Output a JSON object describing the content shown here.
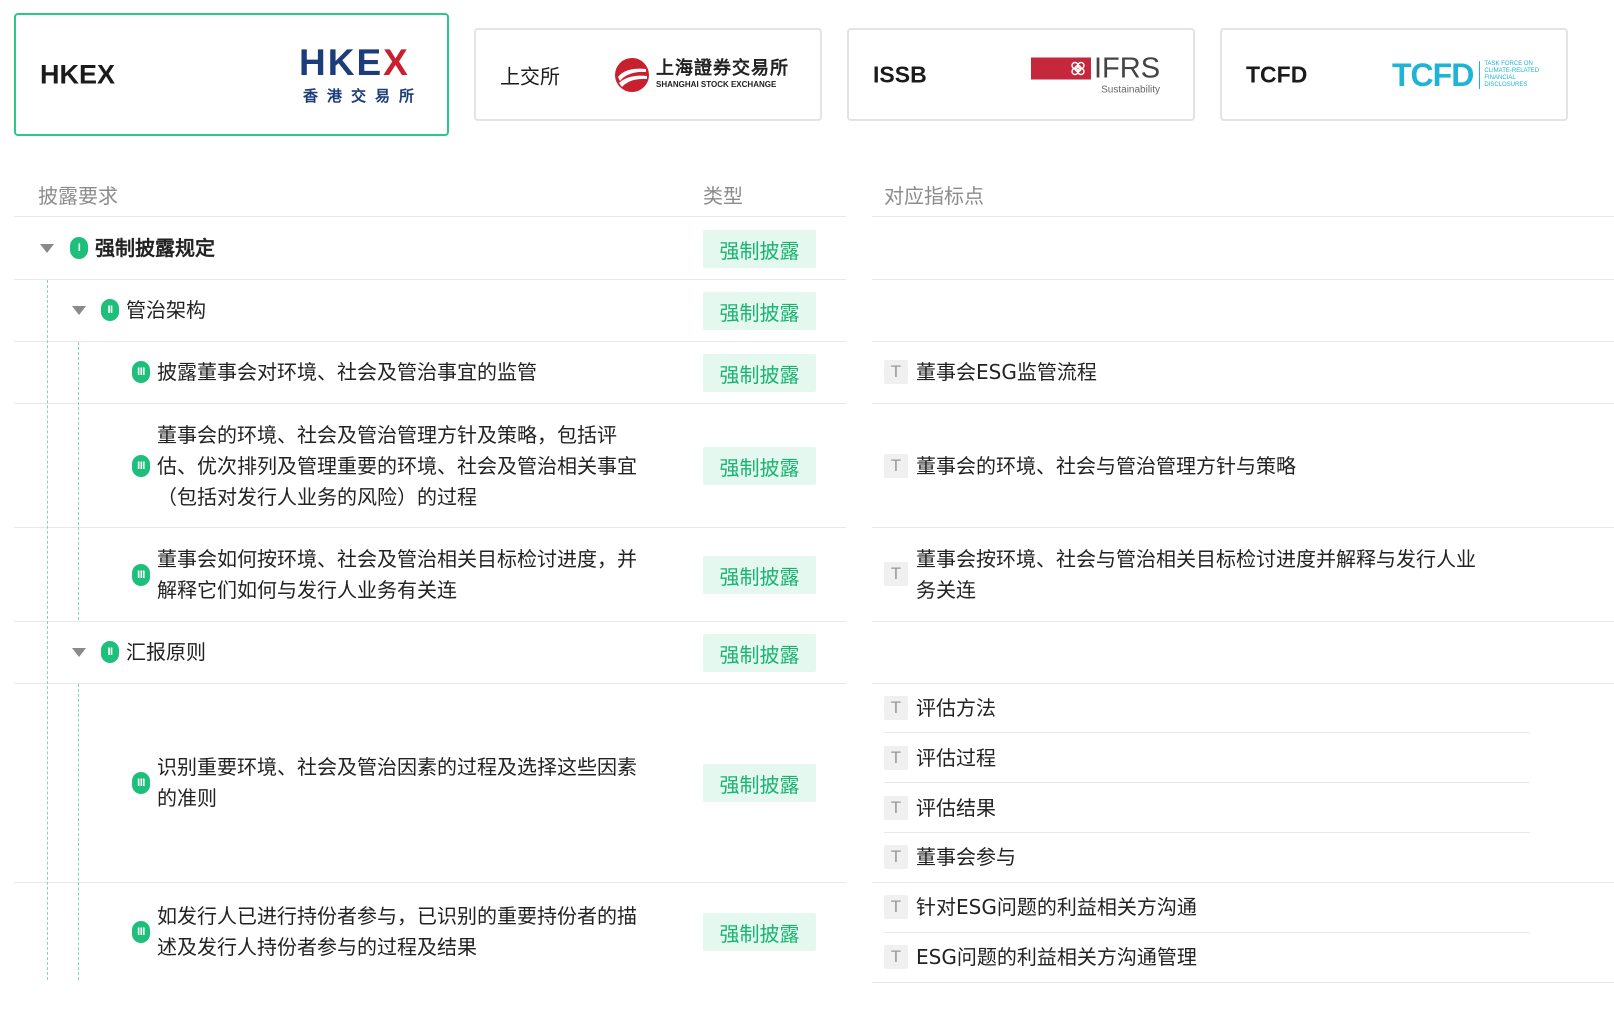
{
  "tabs": [
    {
      "name": "HKEX",
      "logo_main": "HKEX",
      "logo_sub": "香港交易所",
      "active": true
    },
    {
      "name": "上交所",
      "logo_cn": "上海證券交易所",
      "logo_en": "SHANGHAI STOCK EXCHANGE",
      "active": false
    },
    {
      "name": "ISSB",
      "logo_main": "IFRS",
      "logo_sub": "Sustainability",
      "active": false
    },
    {
      "name": "TCFD",
      "logo_main": "TCFD",
      "logo_small": "TASK FORCE ON CLIMATE-RELATED FINANCIAL DISCLOSURES",
      "active": false
    }
  ],
  "table": {
    "headers": {
      "requirement": "披露要求",
      "type": "类型",
      "indicator": "对应指标点"
    },
    "rows": [
      {
        "level": "I",
        "title": "强制披露规定",
        "tag": "强制披露",
        "indicators": []
      },
      {
        "level": "II",
        "title": "管治架构",
        "tag": "强制披露",
        "indicators": []
      },
      {
        "level": "III",
        "title": "披露董事会对环境、社会及管治事宜的监管",
        "tag": "强制披露",
        "indicators": [
          "董事会ESG监管流程"
        ]
      },
      {
        "level": "III",
        "title_lines": [
          "董事会的环境、社会及管治管理方针及策略，包括评",
          "估、优次排列及管理重要的环境、社会及管治相关事宜",
          "（包括对发行人业务的风险）的过程"
        ],
        "tag": "强制披露",
        "indicators": [
          "董事会的环境、社会与管治管理方针与策略"
        ]
      },
      {
        "level": "III",
        "title_lines": [
          "董事会如何按环境、社会及管治相关目标检讨进度，并",
          "解释它们如何与发行人业务有关连"
        ],
        "tag": "强制披露",
        "indicators": [
          [
            "董事会按环境、社会与管治相关目标检讨进度并解释与发行人业",
            "务关连"
          ]
        ]
      },
      {
        "level": "II",
        "title": "汇报原则",
        "tag": "强制披露",
        "indicators": []
      },
      {
        "level": "III",
        "title_lines": [
          "识别重要环境、社会及管治因素的过程及选择这些因素",
          "的准则"
        ],
        "tag": "强制披露",
        "indicators": [
          "评估方法",
          "评估过程",
          "评估结果",
          "董事会参与"
        ]
      },
      {
        "level": "III",
        "title_lines": [
          "如发行人已进行持份者参与，已识别的重要持份者的描",
          "述及发行人持份者参与的过程及结果"
        ],
        "tag": "强制披露",
        "indicators": [
          "针对ESG问题的利益相关方沟通",
          "ESG问题的利益相关方沟通管理"
        ]
      }
    ]
  },
  "icons": {
    "text_type_icon": "T",
    "expand_icon": "caret-down"
  },
  "colors": {
    "accent": "#1dbf7b",
    "tag_bg": "#e4f8ef",
    "tag_text": "#17b470",
    "active_border": "#2cc88a"
  }
}
